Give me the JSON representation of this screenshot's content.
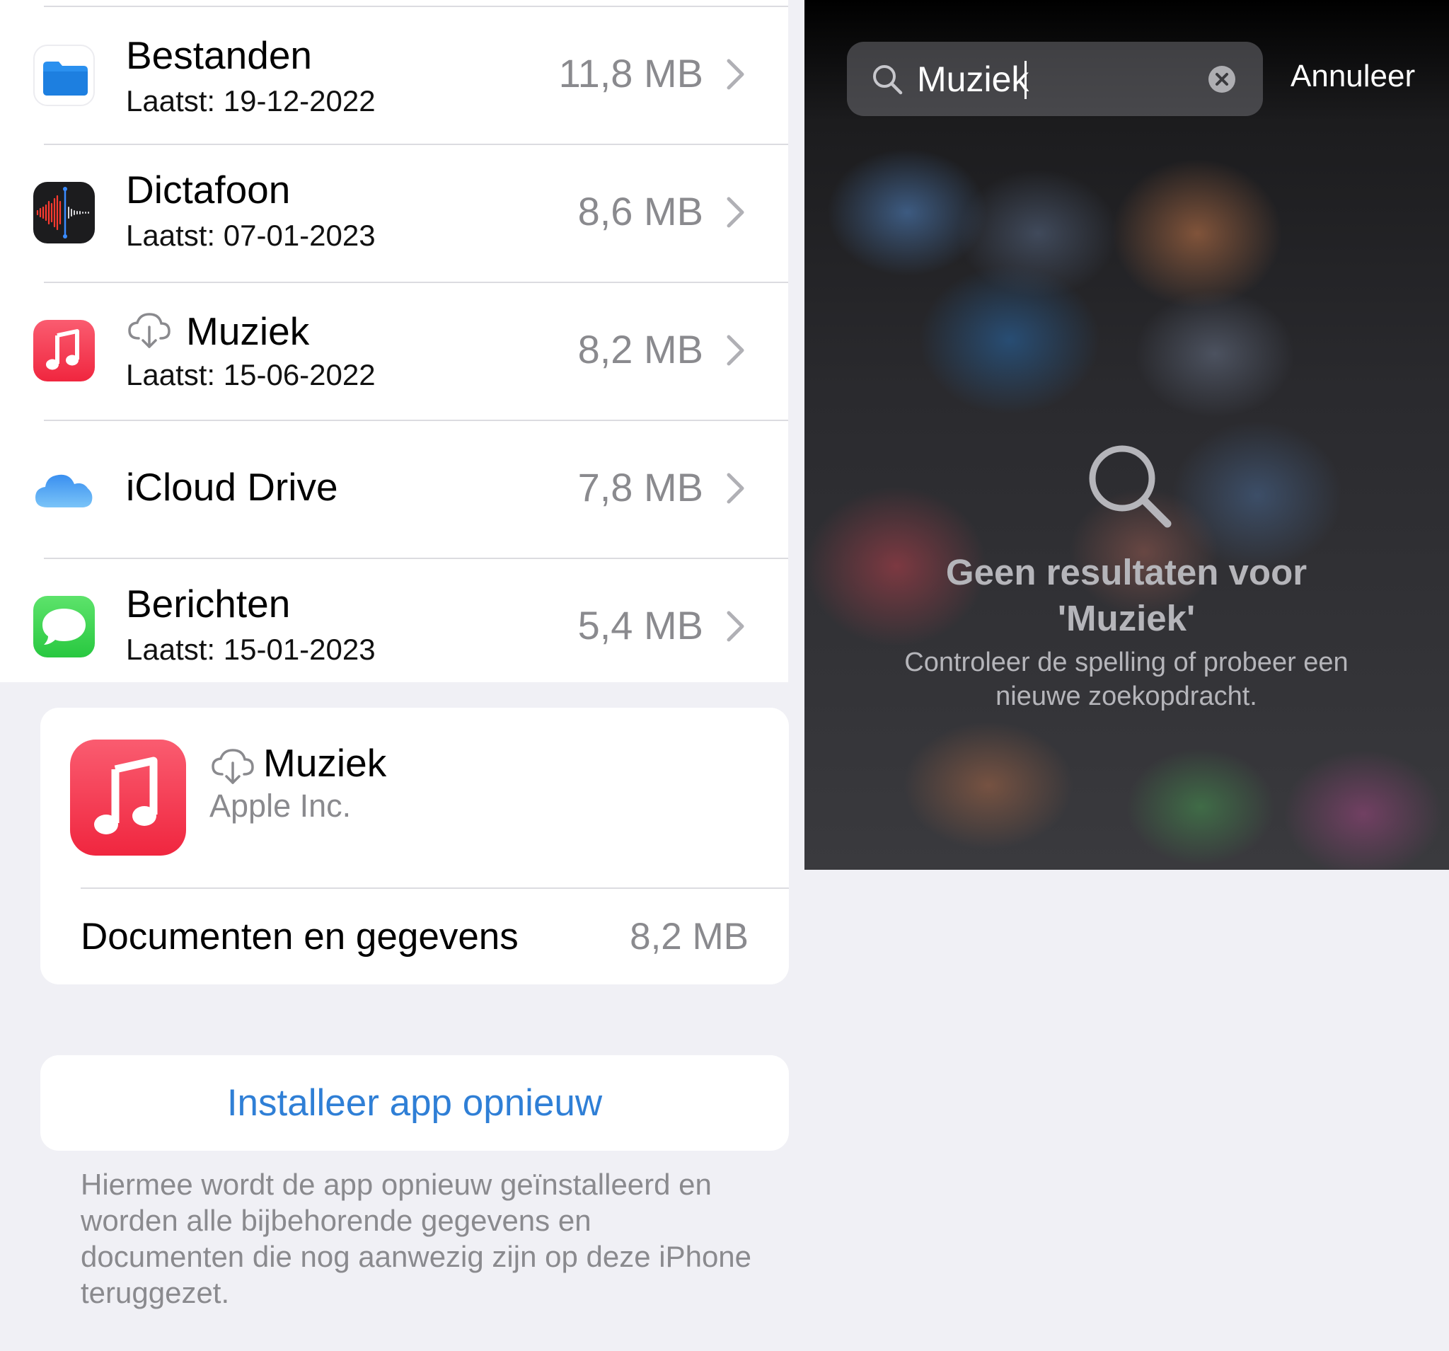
{
  "storage_list": {
    "items": [
      {
        "name": "Bestanden",
        "last_used": "Laatst: 19-12-2022",
        "size": "11,8 MB",
        "icon": "files-folder-icon"
      },
      {
        "name": "Dictafoon",
        "last_used": "Laatst: 07-01-2023",
        "size": "8,6 MB",
        "icon": "voice-memos-icon"
      },
      {
        "name": "Muziek",
        "last_used": "Laatst: 15-06-2022",
        "size": "8,2 MB",
        "icon": "music-icon",
        "offloaded": true
      },
      {
        "name": "iCloud Drive",
        "last_used": "",
        "size": "7,8 MB",
        "icon": "icloud-icon"
      },
      {
        "name": "Berichten",
        "last_used": "Laatst: 15-01-2023",
        "size": "5,4 MB",
        "icon": "messages-icon"
      }
    ]
  },
  "app_detail": {
    "name": "Muziek",
    "vendor": "Apple Inc.",
    "docs_label": "Documenten en gegevens",
    "docs_size": "8,2 MB",
    "reinstall_label": "Installeer app opnieuw",
    "footnote": "Hiermee wordt de app opnieuw geïnstalleerd en worden alle bijbehorende gegevens en documenten die nog aanwezig zijn op deze iPhone teruggezet."
  },
  "spotlight": {
    "query": "Muziek",
    "cancel_label": "Annuleer",
    "no_results_title": "Geen resultaten voor 'Muziek'",
    "no_results_hint": "Controleer de spelling of probeer een nieuwe zoekopdracht."
  },
  "colors": {
    "link_blue": "#2f7fd6",
    "music_red": "#f0263f",
    "secondary_gray": "#8a8a8e",
    "grouped_background": "#f0f0f5"
  }
}
